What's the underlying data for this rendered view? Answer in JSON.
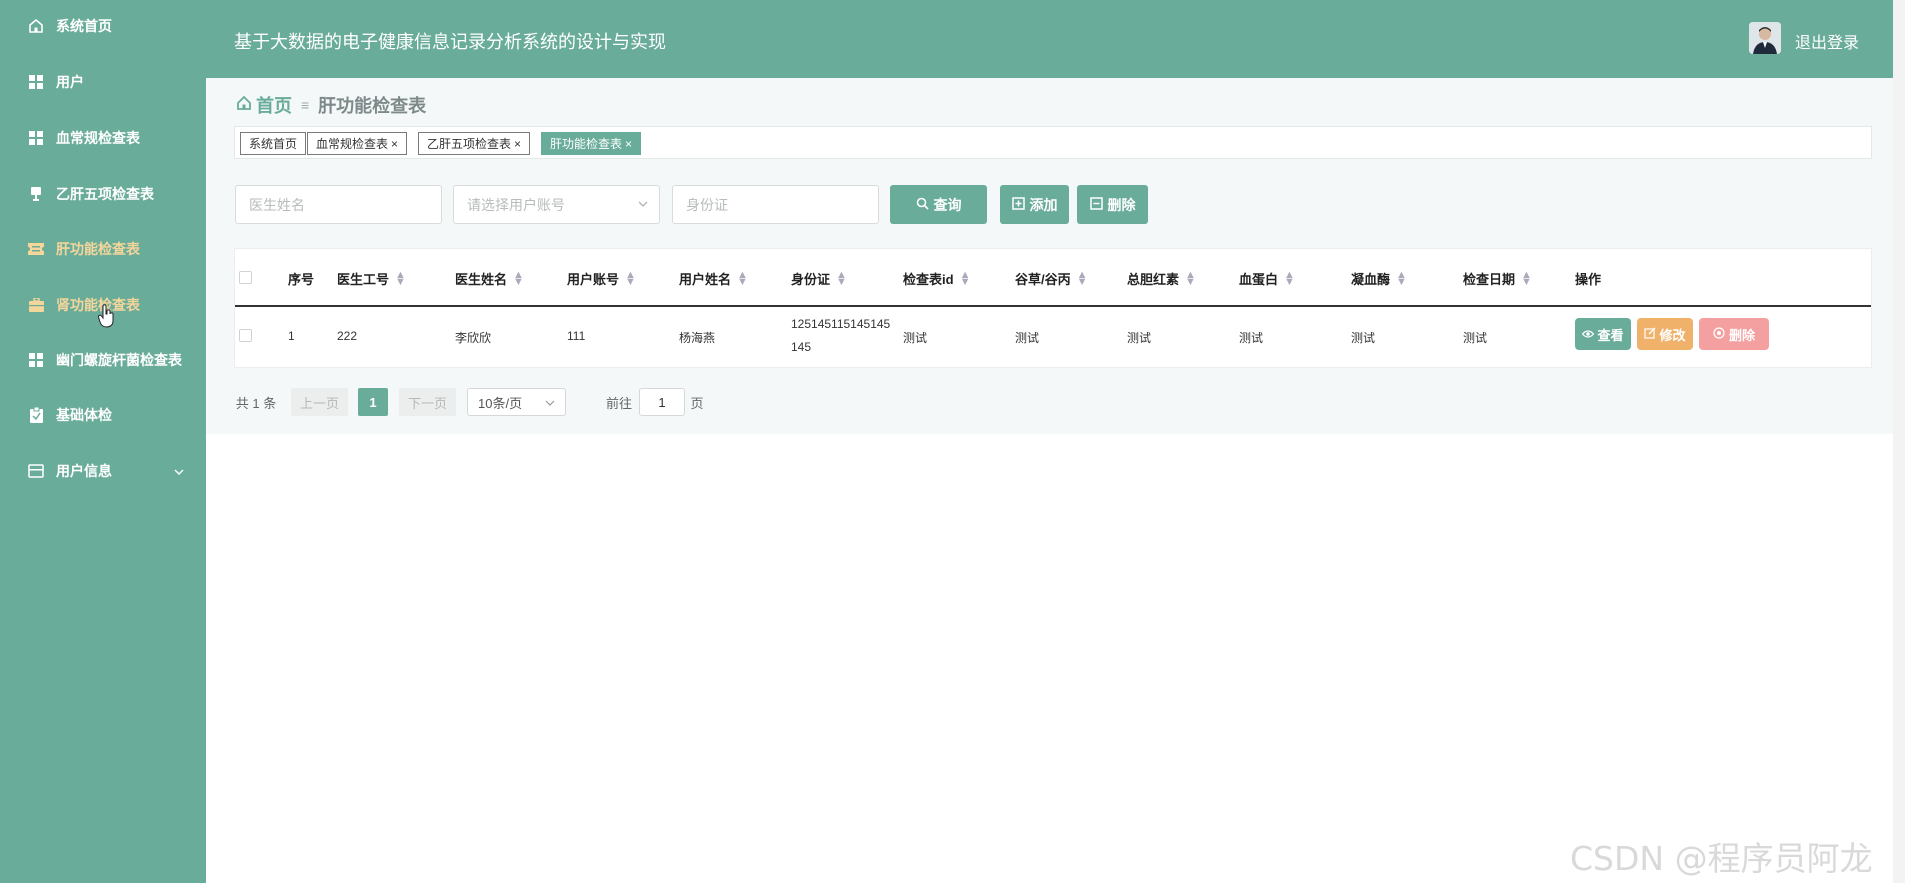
{
  "sidebar": {
    "items": [
      {
        "label": "系统首页",
        "icon": "home-icon"
      },
      {
        "label": "用户",
        "icon": "grid-icon"
      },
      {
        "label": "血常规检查表",
        "icon": "grid-icon"
      },
      {
        "label": "乙肝五项检查表",
        "icon": "cup-icon"
      },
      {
        "label": "肝功能检查表",
        "icon": "ticket-icon"
      },
      {
        "label": "肾功能检查表",
        "icon": "briefcase-icon"
      },
      {
        "label": "幽门螺旋杆菌检查表",
        "icon": "grid-icon"
      },
      {
        "label": "基础体检",
        "icon": "clipboard-icon"
      },
      {
        "label": "用户信息",
        "icon": "wallet-icon"
      }
    ]
  },
  "header": {
    "title": "基于大数据的电子健康信息记录分析系统的设计与实现",
    "logout": "退出登录"
  },
  "breadcrumb": {
    "home": "首页",
    "current": "肝功能检查表"
  },
  "tabs": [
    {
      "label": "系统首页"
    },
    {
      "label": "血常规检查表"
    },
    {
      "label": "乙肝五项检查表"
    },
    {
      "label": "肝功能检查表"
    }
  ],
  "search": {
    "doctor_name_placeholder": "医生姓名",
    "account_placeholder": "请选择用户账号",
    "id_card_placeholder": "身份证",
    "query": "查询",
    "add": "添加",
    "delete": "删除"
  },
  "table": {
    "headers": [
      "序号",
      "医生工号",
      "医生姓名",
      "用户账号",
      "用户姓名",
      "身份证",
      "检查表id",
      "谷草/谷丙",
      "总胆红素",
      "血蛋白",
      "凝血酶",
      "检查日期",
      "操作"
    ],
    "rows": [
      {
        "index": "1",
        "doctor_no": "222",
        "doctor_name": "李欣欣",
        "account": "111",
        "user_name": "杨海燕",
        "id_card_line1": "125145115145145",
        "id_card_line2": "145",
        "check_id": "测试",
        "ast_alt": "测试",
        "bilirubin": "测试",
        "blood_protein": "测试",
        "thrombin": "测试",
        "check_date": "测试"
      }
    ],
    "actions": {
      "view": "查看",
      "edit": "修改",
      "delete": "删除"
    }
  },
  "pagination": {
    "total": "共 1 条",
    "prev": "上一页",
    "page": "1",
    "next": "下一页",
    "page_size": "10条/页",
    "goto_label": "前往",
    "goto_value": "1",
    "goto_unit": "页"
  },
  "watermark": "CSDN @程序员阿龙",
  "colors": {
    "primary": "#6aac9a",
    "active_menu": "#f5d69a",
    "edit": "#f0b26b",
    "delete": "#f4a0a0"
  }
}
